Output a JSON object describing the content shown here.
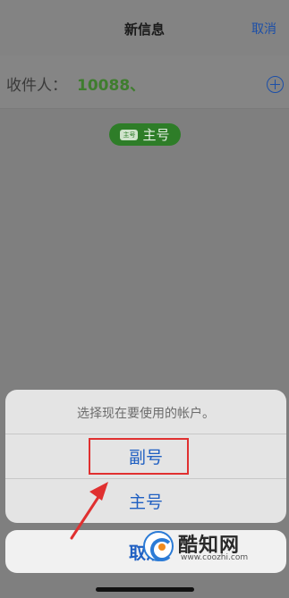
{
  "nav": {
    "title": "新信息",
    "cancel": "取消"
  },
  "recipient": {
    "label": "收件人：",
    "value": "10088、"
  },
  "line_badge": {
    "tag": "主号",
    "label": "主号"
  },
  "action_sheet": {
    "message": "选择现在要使用的帐户。",
    "options": [
      "副号",
      "主号"
    ],
    "cancel": "取消"
  },
  "watermark": {
    "name": "酷知网",
    "url": "www.coozhi.com"
  },
  "colors": {
    "accent": "#1f5fc2",
    "highlight": "#e03030",
    "badge_green": "#2e7d28"
  },
  "icons": [
    "add-recipient-icon",
    "annotation-arrow-icon",
    "watermark-logo-icon"
  ]
}
